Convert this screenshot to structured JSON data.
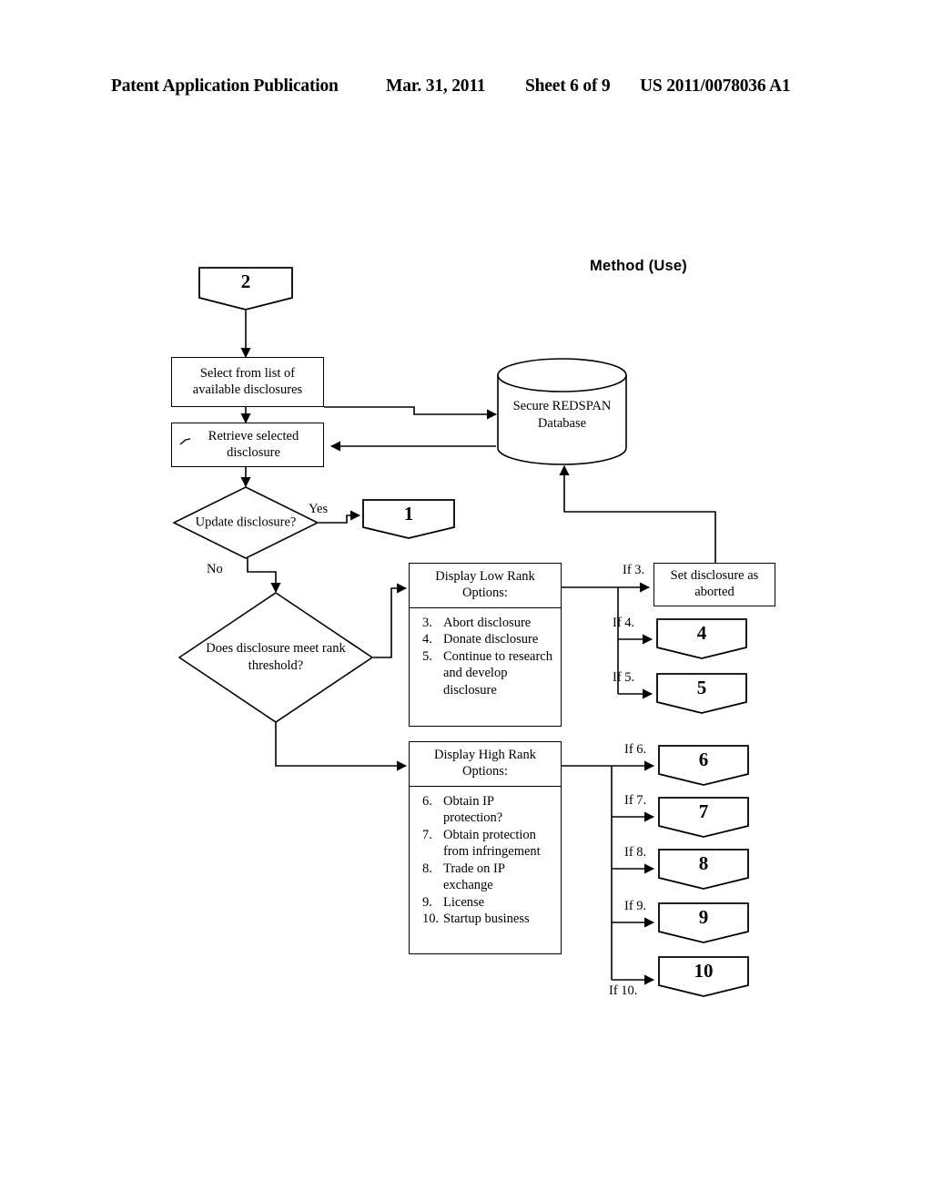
{
  "header": {
    "publication": "Patent Application Publication",
    "date": "Mar. 31, 2011",
    "sheet": "Sheet 6 of 9",
    "number": "US 2011/0078036 A1"
  },
  "figure": {
    "title": "Method (Use)"
  },
  "nodes": {
    "entry_terminal": "2",
    "select_box": "Select from list of available disclosures",
    "retrieve_box": "Retrieve selected disclosure",
    "update_decision": "Update disclosure?",
    "update_yes_terminal": "1",
    "rank_decision": "Does disclosure meet rank threshold?",
    "database": "Secure REDSPAN Database",
    "aborted_box": "Set disclosure as aborted",
    "terminal_4": "4",
    "terminal_5": "5",
    "terminal_6": "6",
    "terminal_7": "7",
    "terminal_8": "8",
    "terminal_9": "9",
    "terminal_10": "10"
  },
  "low_rank_panel": {
    "header": "Display Low Rank Options:",
    "items": [
      {
        "num": "3.",
        "text": "Abort disclosure"
      },
      {
        "num": "4.",
        "text": "Donate disclosure"
      },
      {
        "num": "5.",
        "text": "Continue to research and develop disclosure"
      }
    ]
  },
  "high_rank_panel": {
    "header": "Display High Rank Options:",
    "items": [
      {
        "num": "6.",
        "text": "Obtain IP protection?"
      },
      {
        "num": "7.",
        "text": "Obtain protection from infringement"
      },
      {
        "num": "8.",
        "text": "Trade on IP exchange"
      },
      {
        "num": "9.",
        "text": "License"
      },
      {
        "num": "10.",
        "text": "Startup business"
      }
    ]
  },
  "edge_labels": {
    "yes": "Yes",
    "no": "No",
    "if3": "If 3.",
    "if4": "If 4.",
    "if5": "If 5.",
    "if6": "If 6.",
    "if7": "If 7.",
    "if8": "If 8.",
    "if9": "If 9.",
    "if10": "If  10."
  },
  "colors": {
    "ink": "#000000",
    "paper": "#ffffff"
  }
}
